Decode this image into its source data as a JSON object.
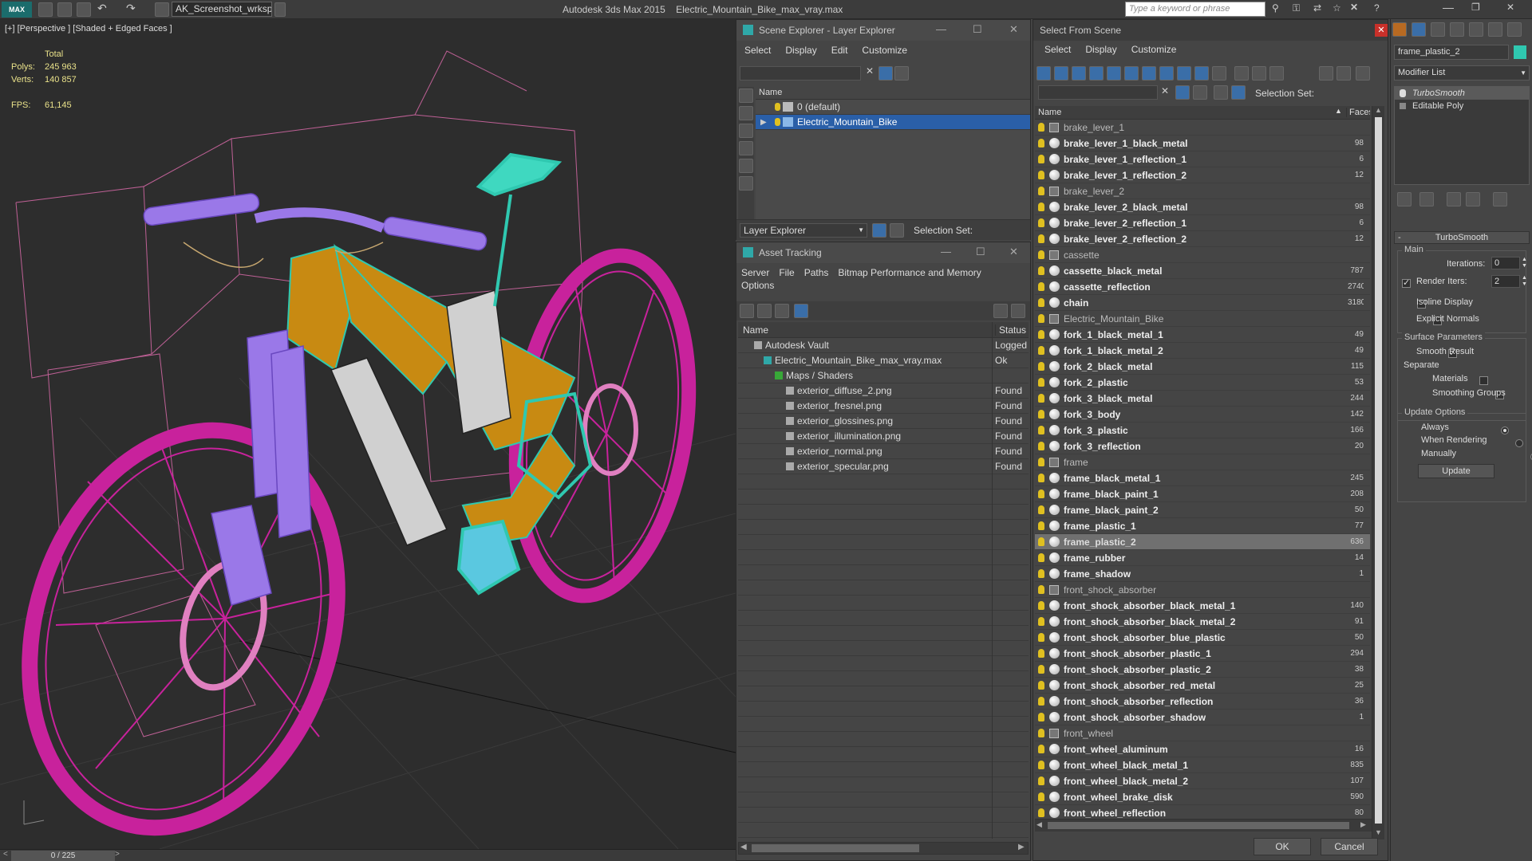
{
  "app": {
    "title": "Autodesk 3ds Max  2015",
    "file": "Electric_Mountain_Bike_max_vray.max",
    "workspace": "AK_Screenshot_wrksp",
    "search_placeholder": "Type a keyword or phrase"
  },
  "viewport": {
    "label": "[+] [Perspective ] [Shaded + Edged Faces ]",
    "stats": {
      "total_label": "Total",
      "polys_label": "Polys:",
      "polys": "245 963",
      "verts_label": "Verts:",
      "verts": "140 857",
      "fps_label": "FPS:",
      "fps": "61,145"
    },
    "timeline": "0 / 225"
  },
  "scene_explorer": {
    "title": "Scene Explorer - Layer Explorer",
    "menu": [
      "Select",
      "Display",
      "Edit",
      "Customize"
    ],
    "col_name": "Name",
    "layers": [
      "0 (default)",
      "Electric_Mountain_Bike"
    ],
    "footer": {
      "dropdown": "Layer Explorer",
      "selection_set": "Selection Set:"
    }
  },
  "asset_tracking": {
    "title": "Asset Tracking",
    "menu": [
      "Server",
      "File",
      "Paths",
      "Bitmap Performance and Memory"
    ],
    "menu2": "Options",
    "col_name": "Name",
    "col_status": "Status",
    "rows": [
      {
        "name": "Autodesk Vault",
        "status": "Logged",
        "indent": 0
      },
      {
        "name": "Electric_Mountain_Bike_max_vray.max",
        "status": "Ok",
        "indent": 1
      },
      {
        "name": "Maps / Shaders",
        "status": "",
        "indent": 2
      },
      {
        "name": "exterior_diffuse_2.png",
        "status": "Found",
        "indent": 3
      },
      {
        "name": "exterior_fresnel.png",
        "status": "Found",
        "indent": 3
      },
      {
        "name": "exterior_glossines.png",
        "status": "Found",
        "indent": 3
      },
      {
        "name": "exterior_illumination.png",
        "status": "Found",
        "indent": 3
      },
      {
        "name": "exterior_normal.png",
        "status": "Found",
        "indent": 3
      },
      {
        "name": "exterior_specular.png",
        "status": "Found",
        "indent": 3
      }
    ]
  },
  "select_from_scene": {
    "title": "Select From Scene",
    "menu": [
      "Select",
      "Display",
      "Customize"
    ],
    "selection_set": "Selection Set:",
    "col_name": "Name",
    "col_faces": "Faces",
    "ok": "OK",
    "cancel": "Cancel",
    "items": [
      {
        "name": "brake_lever_1",
        "faces": "",
        "group": true
      },
      {
        "name": "brake_lever_1_black_metal",
        "faces": "98"
      },
      {
        "name": "brake_lever_1_reflection_1",
        "faces": "6"
      },
      {
        "name": "brake_lever_1_reflection_2",
        "faces": "12"
      },
      {
        "name": "brake_lever_2",
        "faces": "",
        "group": true
      },
      {
        "name": "brake_lever_2_black_metal",
        "faces": "98"
      },
      {
        "name": "brake_lever_2_reflection_1",
        "faces": "6"
      },
      {
        "name": "brake_lever_2_reflection_2",
        "faces": "12"
      },
      {
        "name": "cassette",
        "faces": "",
        "group": true
      },
      {
        "name": "cassette_black_metal",
        "faces": "787"
      },
      {
        "name": "cassette_reflection",
        "faces": "2740"
      },
      {
        "name": "chain",
        "faces": "3180"
      },
      {
        "name": "Electric_Mountain_Bike",
        "faces": "",
        "group": true
      },
      {
        "name": "fork_1_black_metal_1",
        "faces": "49"
      },
      {
        "name": "fork_1_black_metal_2",
        "faces": "49"
      },
      {
        "name": "fork_2_black_metal",
        "faces": "115"
      },
      {
        "name": "fork_2_plastic",
        "faces": "53"
      },
      {
        "name": "fork_3_black_metal",
        "faces": "244"
      },
      {
        "name": "fork_3_body",
        "faces": "142"
      },
      {
        "name": "fork_3_plastic",
        "faces": "166"
      },
      {
        "name": "fork_3_reflection",
        "faces": "20"
      },
      {
        "name": "frame",
        "faces": "",
        "group": true
      },
      {
        "name": "frame_black_metal_1",
        "faces": "245"
      },
      {
        "name": "frame_black_paint_1",
        "faces": "208"
      },
      {
        "name": "frame_black_paint_2",
        "faces": "50"
      },
      {
        "name": "frame_plastic_1",
        "faces": "77"
      },
      {
        "name": "frame_plastic_2",
        "faces": "636",
        "selected": true
      },
      {
        "name": "frame_rubber",
        "faces": "14"
      },
      {
        "name": "frame_shadow",
        "faces": "1"
      },
      {
        "name": "front_shock_absorber",
        "faces": "",
        "group": true
      },
      {
        "name": "front_shock_absorber_black_metal_1",
        "faces": "140"
      },
      {
        "name": "front_shock_absorber_black_metal_2",
        "faces": "91"
      },
      {
        "name": "front_shock_absorber_blue_plastic",
        "faces": "50"
      },
      {
        "name": "front_shock_absorber_plastic_1",
        "faces": "294"
      },
      {
        "name": "front_shock_absorber_plastic_2",
        "faces": "38"
      },
      {
        "name": "front_shock_absorber_red_metal",
        "faces": "25"
      },
      {
        "name": "front_shock_absorber_reflection",
        "faces": "36"
      },
      {
        "name": "front_shock_absorber_shadow",
        "faces": "1"
      },
      {
        "name": "front_wheel",
        "faces": "",
        "group": true
      },
      {
        "name": "front_wheel_aluminum",
        "faces": "16"
      },
      {
        "name": "front_wheel_black_metal_1",
        "faces": "835"
      },
      {
        "name": "front_wheel_black_metal_2",
        "faces": "107"
      },
      {
        "name": "front_wheel_brake_disk",
        "faces": "590"
      },
      {
        "name": "front_wheel_reflection",
        "faces": "80"
      }
    ]
  },
  "modify_panel": {
    "object_name": "frame_plastic_2",
    "modifier_list": "Modifier List",
    "stack": [
      "TurboSmooth",
      "Editable Poly"
    ],
    "rollout_title": "TurboSmooth",
    "main_label": "Main",
    "iterations_label": "Iterations:",
    "iterations": "0",
    "render_iters_label": "Render Iters:",
    "render_iters": "2",
    "isoline": "Isoline Display",
    "explicit_normals": "Explicit Normals",
    "surface_params": "Surface Parameters",
    "smooth_result": "Smooth Result",
    "separate": "Separate",
    "materials": "Materials",
    "smoothing_groups": "Smoothing Groups",
    "update_options": "Update Options",
    "always": "Always",
    "when_rendering": "When Rendering",
    "manually": "Manually",
    "update_btn": "Update"
  },
  "colors": {
    "accent_select": "#2a5fa8",
    "selected_row": "#707070",
    "wire_magenta": "#c8229c",
    "wire_orange": "#d08a10",
    "wire_teal": "#2fc8b0",
    "wire_purple": "#8c6ce0"
  }
}
